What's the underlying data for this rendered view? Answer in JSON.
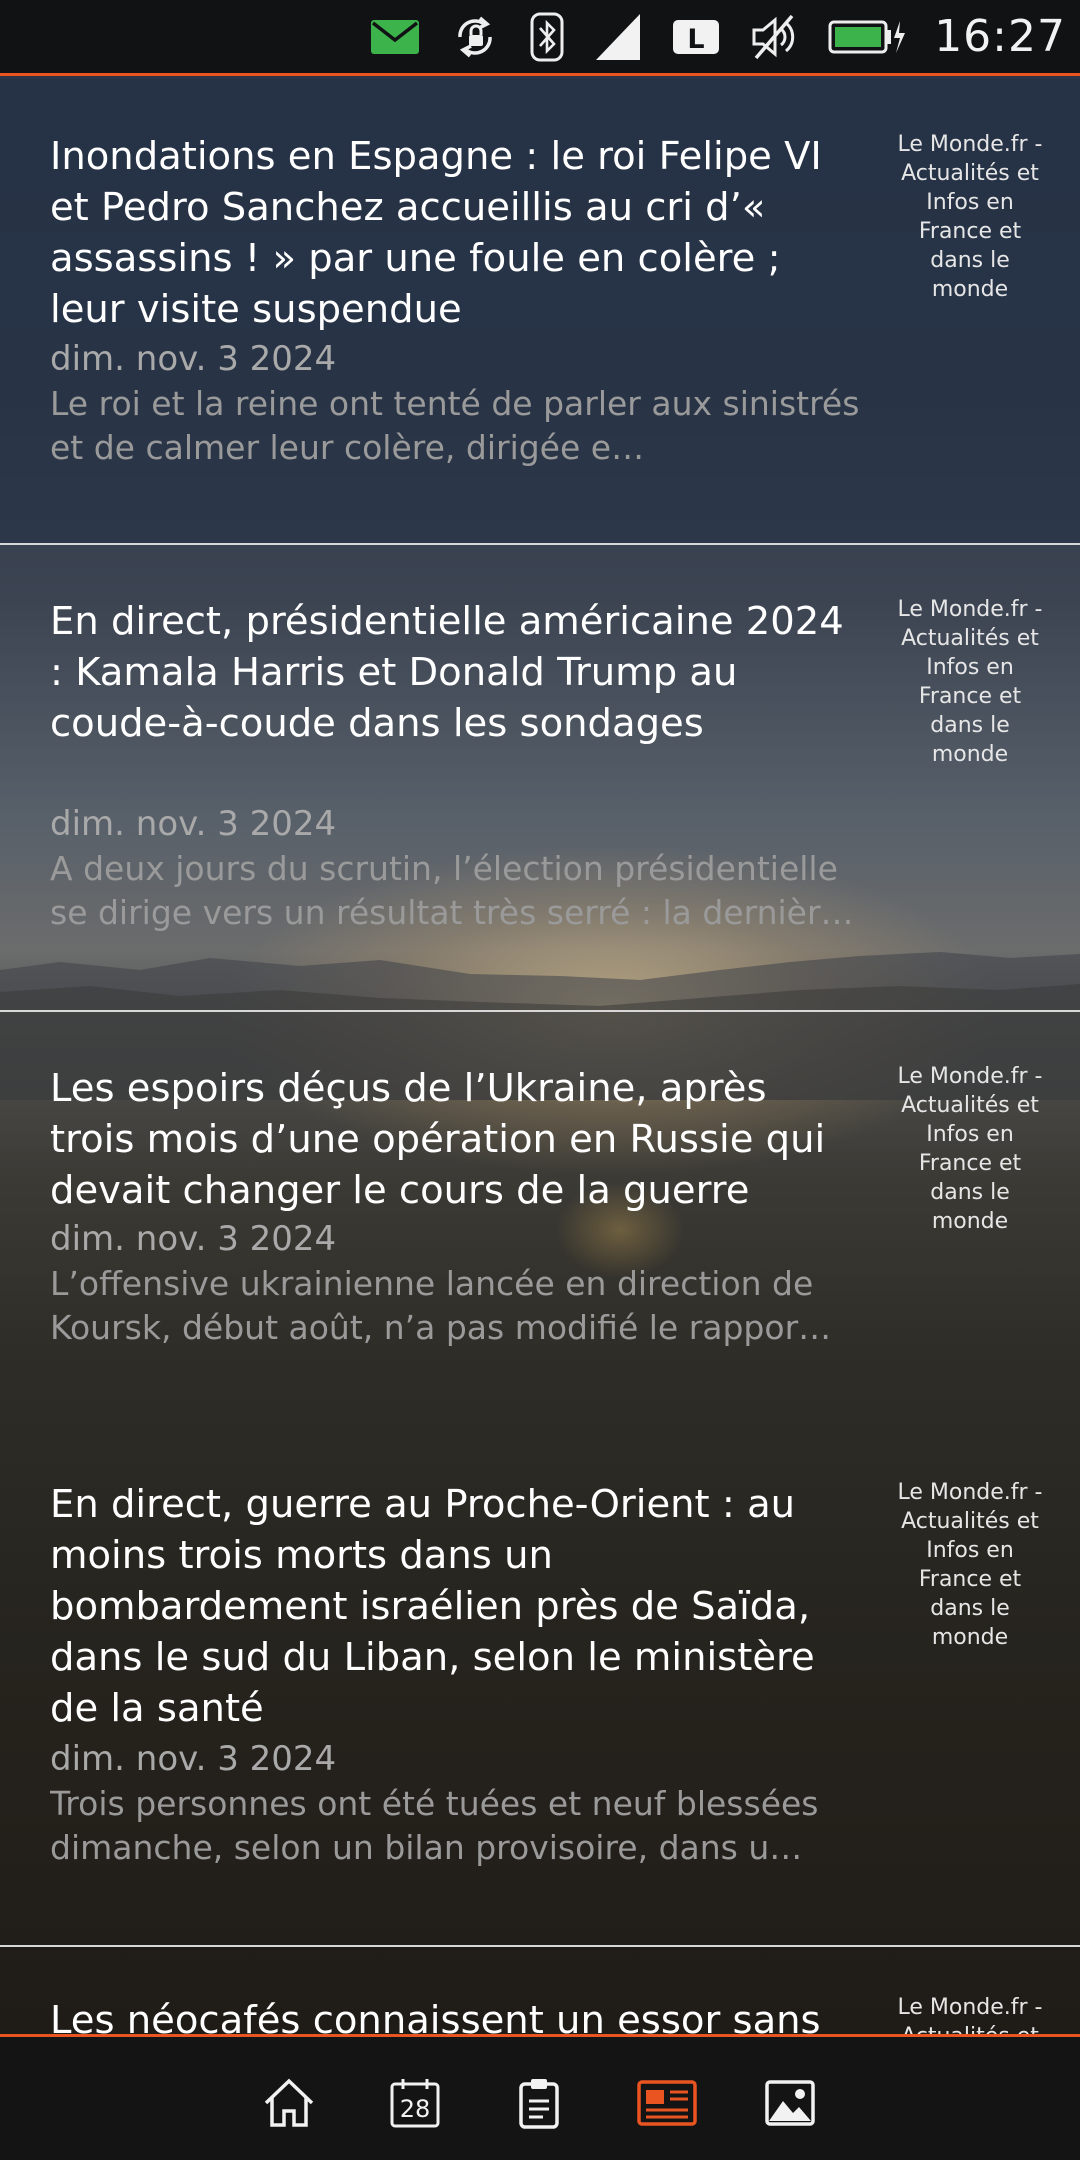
{
  "status_bar": {
    "time": "16:27",
    "network_label": "L",
    "icons": [
      "mail-icon",
      "rotation-lock-icon",
      "bluetooth-icon",
      "signal-icon",
      "network-type-icon",
      "mute-icon",
      "battery-charging-icon"
    ],
    "accent_color": "#e95420"
  },
  "articles": [
    {
      "title": "Inondations en Espagne : le roi Felipe VI et Pedro Sanchez accueillis au cri d’« assassins ! » par une foule en colère ; leur visite suspendue",
      "date": "dim. nov. 3 2024",
      "summary": "Le roi et la reine ont tenté de parler aux sinistrés et de calmer leur colère, dirigée e…",
      "source": "Le Monde.fr - Actualités et Infos en France et dans le monde"
    },
    {
      "title": "En direct, présidentielle américaine 2024 : Kamala Harris et Donald Trump au coude-à-coude dans les sondages",
      "date": "dim. nov. 3 2024",
      "summary": "A deux jours du scrutin, l’élection présidentielle se dirige vers un résultat très serré : la dernièr…",
      "source": "Le Monde.fr - Actualités et Infos en France et dans le monde"
    },
    {
      "title": "Les espoirs déçus de l’Ukraine, après trois mois d’une opération en Russie qui devait changer le cours de la guerre",
      "date": "dim. nov. 3 2024",
      "summary": "L’offensive ukrainienne lancée en direction de Koursk, début août, n’a pas modifié le rappor…",
      "source": "Le Monde.fr - Actualités et Infos en France et dans le monde"
    },
    {
      "title": "En direct, guerre au Proche-Orient : au moins trois morts dans un bombardement israélien près de Saïda, dans le sud du Liban, selon le ministère de la santé",
      "date": "dim. nov. 3 2024",
      "summary": "Trois personnes ont été tuées et neuf blessées dimanche, selon un bilan provisoire, dans u…",
      "source": "Le Monde.fr - Actualités et Infos en France et dans le monde"
    },
    {
      "title": "Les néocafés connaissent un essor sans",
      "source": "Le Monde.fr - Actualités et Infos en France et dans le monde"
    }
  ],
  "bottom_nav": {
    "calendar_day": "28",
    "items": [
      "home-icon",
      "calendar-icon",
      "clipboard-icon",
      "news-icon",
      "gallery-icon"
    ],
    "active_item": "news-icon",
    "active_color": "#e95420"
  }
}
